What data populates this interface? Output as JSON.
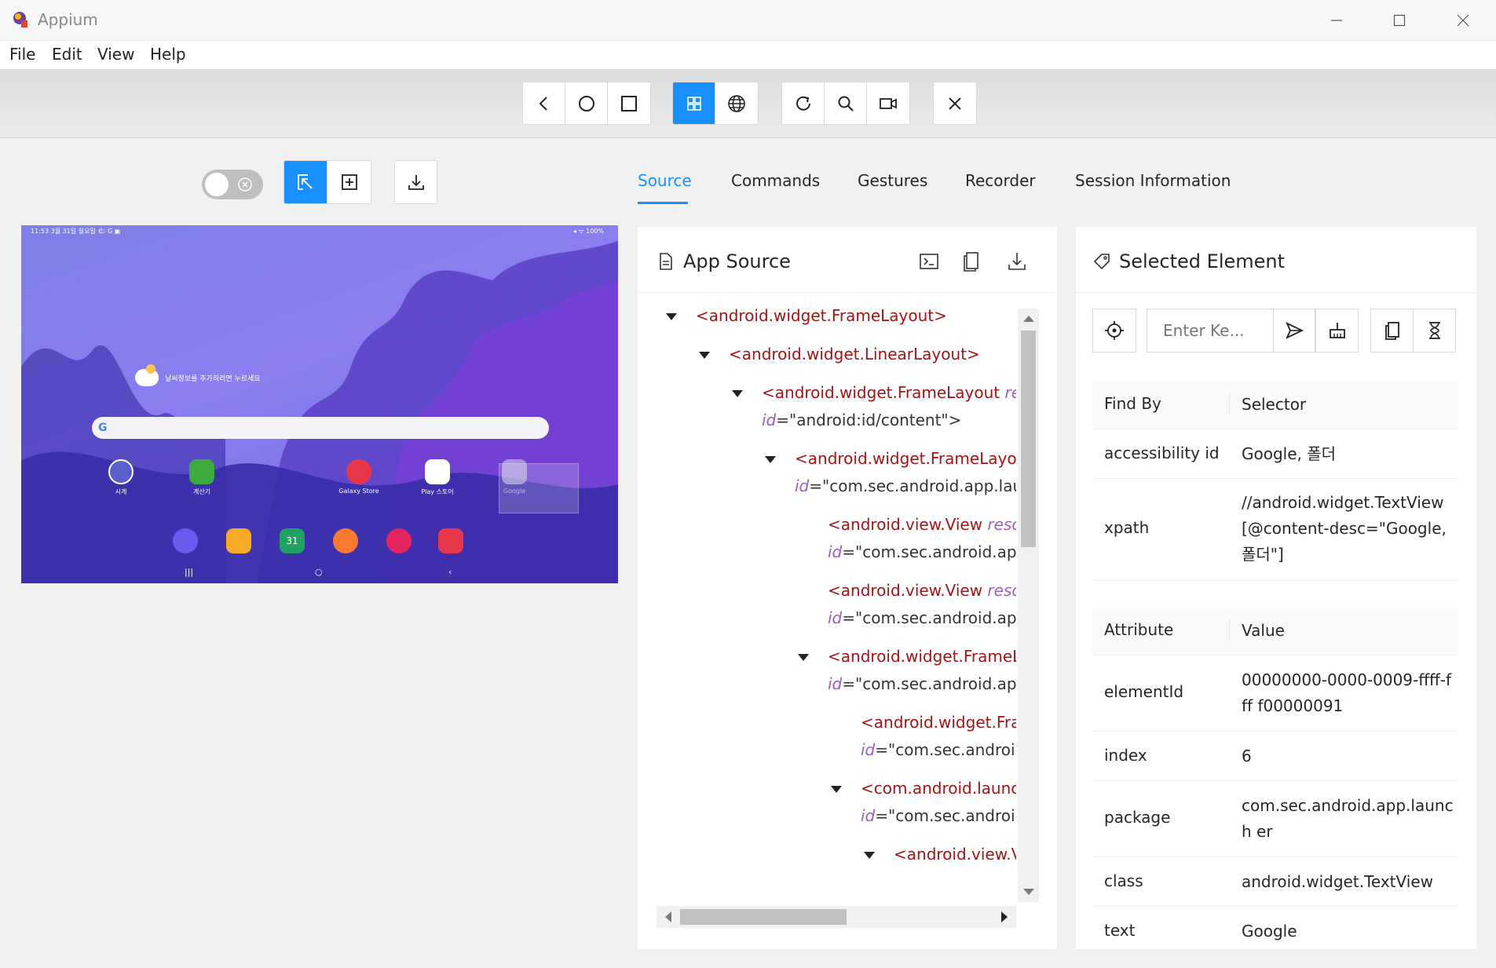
{
  "window": {
    "title": "Appium",
    "menu": [
      "File",
      "Edit",
      "View",
      "Help"
    ]
  },
  "toolbar": {
    "icons": [
      "back-icon",
      "home-icon",
      "app-switch-icon",
      "native-mode-icon",
      "web-mode-icon",
      "refresh-icon",
      "search-icon",
      "record-icon",
      "close-icon"
    ],
    "active_mode": "native-mode-icon",
    "accent": "#1890ff"
  },
  "device": {
    "status_left": "11:53  3월 31일 월요일  🌤 G ▣",
    "status_right": "◂ ᯤ 100%",
    "weather_text": "날씨정보를 추가하려면 누르세요",
    "apps": [
      {
        "label": "시계",
        "color": "#5a5fd0"
      },
      {
        "label": "계산기",
        "color": "#3caa3c"
      },
      {
        "label": "Galaxy Store",
        "color": "#e8374a"
      },
      {
        "label": "Play 스토어",
        "color": "#ffffff"
      },
      {
        "label": "Google",
        "color": "#d8d8e8"
      }
    ],
    "dock_badge": "31"
  },
  "tabs": [
    "Source",
    "Commands",
    "Gestures",
    "Recorder",
    "Session Information"
  ],
  "active_tab": "Source",
  "app_source": {
    "title": "App Source",
    "tree": [
      {
        "indent": 0,
        "caret": true,
        "tag": "<android.widget.FrameLayout>",
        "attr": "",
        "val": ""
      },
      {
        "indent": 1,
        "caret": true,
        "tag": "<android.widget.LinearLayout>",
        "attr": "",
        "val": ""
      },
      {
        "indent": 2,
        "caret": true,
        "tag": "<android.widget.FrameLayout ",
        "attr": "resou",
        "val": ""
      },
      {
        "indent": 2,
        "caret": false,
        "tag": "",
        "attr": "id",
        "val": "=\"android:id/content\">"
      },
      {
        "indent": 3,
        "caret": true,
        "tag": "<android.widget.FrameLayout ",
        "attr": "",
        "val": ""
      },
      {
        "indent": 3,
        "caret": false,
        "tag": "",
        "attr": "id",
        "val": "=\"com.sec.android.app.launc"
      },
      {
        "indent": 4,
        "caret": false,
        "tag": "<android.view.View ",
        "attr": "resour",
        "val": ""
      },
      {
        "indent": 4,
        "caret": false,
        "tag": "",
        "attr": "id",
        "val": "=\"com.sec.android.app.l"
      },
      {
        "indent": 4,
        "caret": false,
        "tag": "<android.view.View ",
        "attr": "resour",
        "val": ""
      },
      {
        "indent": 4,
        "caret": false,
        "tag": "",
        "attr": "id",
        "val": "=\"com.sec.android.app.l"
      },
      {
        "indent": 4,
        "caret": true,
        "tag": "<android.widget.FrameLay",
        "attr": "",
        "val": ""
      },
      {
        "indent": 4,
        "caret": false,
        "tag": "",
        "attr": "id",
        "val": "=\"com.sec.android.app.l"
      },
      {
        "indent": 5,
        "caret": false,
        "tag": "<android.widget.Fram",
        "attr": "",
        "val": ""
      },
      {
        "indent": 5,
        "caret": false,
        "tag": "",
        "attr": "id",
        "val": "=\"com.sec.android.a"
      },
      {
        "indent": 5,
        "caret": true,
        "tag": "<com.android.launche",
        "attr": "",
        "val": ""
      },
      {
        "indent": 5,
        "caret": false,
        "tag": "",
        "attr": "id",
        "val": "=\"com.sec.android.a"
      },
      {
        "indent": 6,
        "caret": true,
        "tag": "<android.view.Vi",
        "attr": "",
        "val": ""
      }
    ]
  },
  "selected_element": {
    "title": "Selected Element",
    "input_placeholder": "Enter Ke...",
    "find_by_header": [
      "Find By",
      "Selector"
    ],
    "find_by": [
      {
        "key": "accessibility id",
        "value": "Google, 폴더"
      },
      {
        "key": "xpath",
        "value": "//android.widget.TextView [@content-desc=\"Google, 폴더\"]"
      }
    ],
    "attr_header": [
      "Attribute",
      "Value"
    ],
    "attributes": [
      {
        "key": "elementId",
        "value": "00000000-0000-0009-ffff-fff f00000091"
      },
      {
        "key": "index",
        "value": "6"
      },
      {
        "key": "package",
        "value": "com.sec.android.app.launch er"
      },
      {
        "key": "class",
        "value": "android.widget.TextView"
      },
      {
        "key": "text",
        "value": "Google"
      }
    ]
  }
}
